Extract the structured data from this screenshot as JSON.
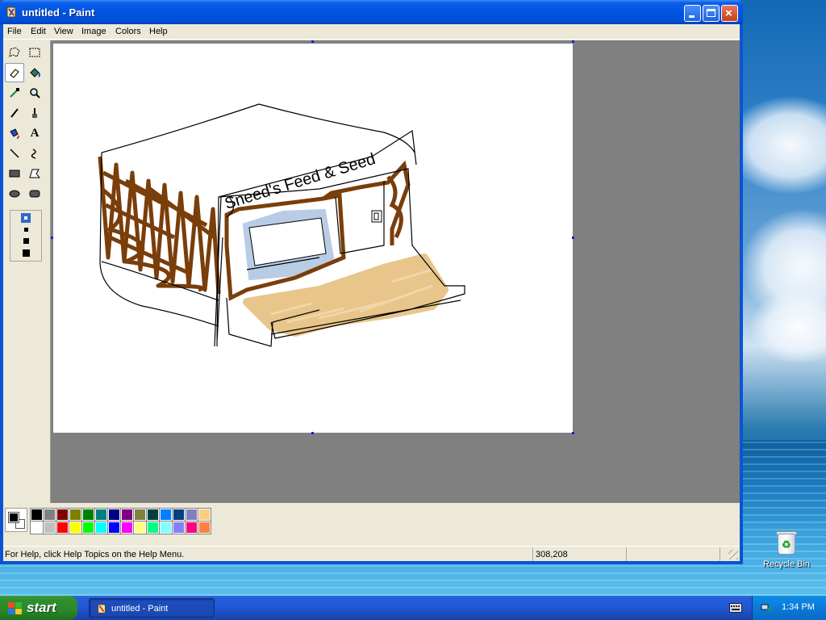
{
  "window": {
    "title": "untitled - Paint",
    "controls": {
      "minimize": "minimize",
      "maximize": "maximize",
      "close": "×"
    }
  },
  "menu": [
    "File",
    "Edit",
    "View",
    "Image",
    "Colors",
    "Help"
  ],
  "tools": [
    {
      "name": "free-form-select-icon",
      "selected": false
    },
    {
      "name": "select-icon",
      "selected": false
    },
    {
      "name": "eraser-icon",
      "selected": true
    },
    {
      "name": "fill-icon",
      "selected": false
    },
    {
      "name": "pick-color-icon",
      "selected": false
    },
    {
      "name": "magnifier-icon",
      "selected": false
    },
    {
      "name": "pencil-icon",
      "selected": false
    },
    {
      "name": "brush-icon",
      "selected": false
    },
    {
      "name": "airbrush-icon",
      "selected": false
    },
    {
      "name": "text-icon",
      "selected": false
    },
    {
      "name": "line-icon",
      "selected": false
    },
    {
      "name": "curve-icon",
      "selected": false
    },
    {
      "name": "rectangle-icon",
      "selected": false
    },
    {
      "name": "polygon-icon",
      "selected": false
    },
    {
      "name": "ellipse-icon",
      "selected": false
    },
    {
      "name": "rounded-rectangle-icon",
      "selected": false
    }
  ],
  "text_tool_glyph": "A",
  "palette": {
    "foreground": "#000000",
    "background": "#ffffff",
    "top": [
      "#000000",
      "#808080",
      "#800000",
      "#808000",
      "#008000",
      "#008080",
      "#000080",
      "#800080",
      "#808040",
      "#004040",
      "#0080ff",
      "#004080",
      "#8080c0",
      "#ffcc80"
    ],
    "bottom": [
      "#ffffff",
      "#c0c0c0",
      "#ff0000",
      "#ffff00",
      "#00ff00",
      "#00ffff",
      "#0000ff",
      "#ff00ff",
      "#ffff80",
      "#00ff80",
      "#80ffff",
      "#8080ff",
      "#ff0080",
      "#ff8040"
    ]
  },
  "drawing": {
    "sign_text": "Sneed's Feed & Seed",
    "colors": {
      "brown": "#7a3e0a",
      "tan": "#e8c58a",
      "light_blue": "#b9cce6",
      "ink": "#000000"
    }
  },
  "status": {
    "help_text": "For Help, click Help Topics on the Help Menu.",
    "coordinates": "308,208"
  },
  "desktop": {
    "recycle_bin_label": "Recycle Bin"
  },
  "taskbar": {
    "start_label": "start",
    "task_button": "untitled - Paint",
    "clock": "1:34 PM"
  }
}
